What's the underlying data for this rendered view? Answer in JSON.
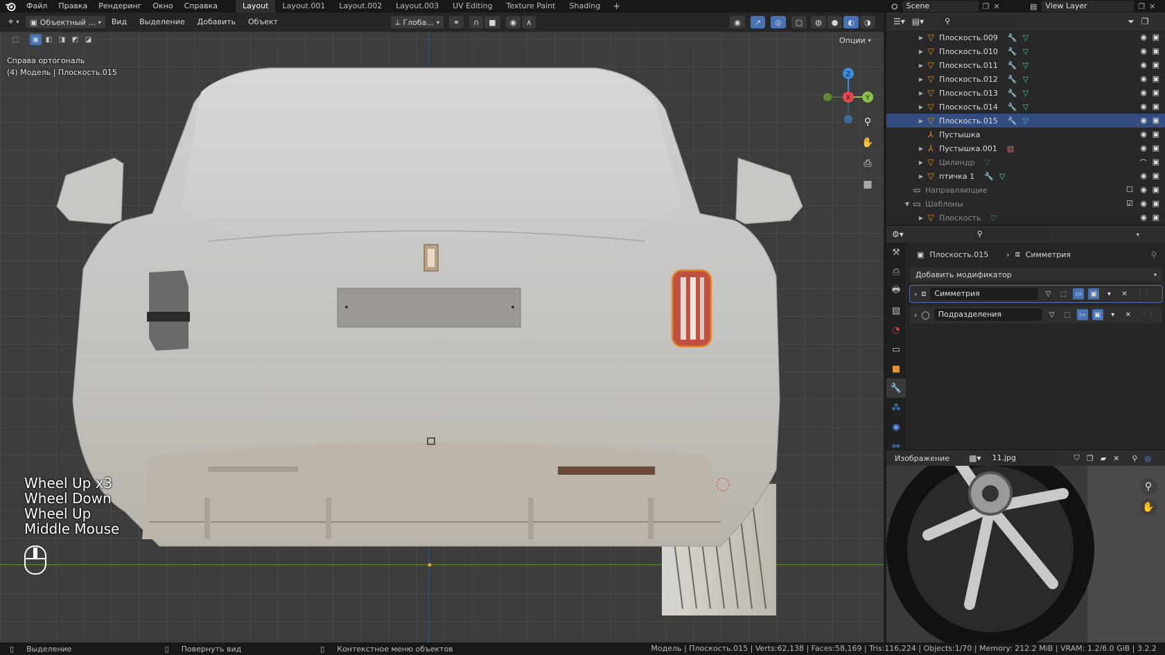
{
  "menu": [
    "Файл",
    "Правка",
    "Рендеринг",
    "Окно",
    "Справка"
  ],
  "workspace_tabs": [
    {
      "label": "Layout",
      "active": true
    },
    {
      "label": "Layout.001",
      "active": false
    },
    {
      "label": "Layout.002",
      "active": false
    },
    {
      "label": "Layout.003",
      "active": false
    },
    {
      "label": "UV Editing",
      "active": false
    },
    {
      "label": "Texture Paint",
      "active": false
    },
    {
      "label": "Shading",
      "active": false
    }
  ],
  "add_tab_glyph": "+",
  "scene": "Scene",
  "view_layer": "View Layer",
  "viewport": {
    "mode": "Объектный ...",
    "menus": [
      "Вид",
      "Выделение",
      "Добавить",
      "Объект"
    ],
    "transform_orientation": "Глоба...",
    "options": "Опции",
    "view_name": "Справа ортогональ",
    "object_info": "(4) Модель | Плоскость.015",
    "keys": [
      "Wheel Up x3",
      "Wheel Down",
      "Wheel Up",
      "Middle Mouse"
    ],
    "axes": {
      "x": "X",
      "y": "Y",
      "z": "Z"
    },
    "x_color": "#e8474f",
    "y_color": "#8bc34a",
    "z_color": "#3d8fdb"
  },
  "outliner": {
    "rows": [
      {
        "name": "Плоскость.009",
        "selected": false,
        "dim": false
      },
      {
        "name": "Плоскость.010",
        "selected": false,
        "dim": false
      },
      {
        "name": "Плоскость.011",
        "selected": false,
        "dim": false
      },
      {
        "name": "Плоскость.012",
        "selected": false,
        "dim": false
      },
      {
        "name": "Плоскость.013",
        "selected": false,
        "dim": false
      },
      {
        "name": "Плоскость.014",
        "selected": false,
        "dim": false
      },
      {
        "name": "Плоскость.015",
        "selected": true,
        "dim": false
      },
      {
        "name": "Пустышка",
        "selected": false,
        "dim": false
      },
      {
        "name": "Пустышка.001",
        "selected": false,
        "dim": false
      },
      {
        "name": "Цилиндр",
        "selected": false,
        "dim": true
      },
      {
        "name": "птичка 1",
        "selected": false,
        "dim": false
      },
      {
        "name": "Направляющие",
        "selected": false,
        "dim": true
      },
      {
        "name": "Шаблоны",
        "selected": false,
        "dim": true
      },
      {
        "name": "Плоскость",
        "selected": false,
        "dim": true
      }
    ]
  },
  "properties": {
    "object": "Плоскость.015",
    "modifier_context": "Симметрия",
    "add_modifier": "Добавить модификатор",
    "modifiers": [
      {
        "name": "Симметрия",
        "active": true
      },
      {
        "name": "Подразделения",
        "active": false
      }
    ]
  },
  "image_editor": {
    "mode": "Изображение",
    "image_name": "11.jpg"
  },
  "statusbar": {
    "select": "Выделение",
    "rotate": "Повернуть вид",
    "context": "Контекстное меню объектов",
    "stats": "Модель | Плоскость.015 | Verts:62,138 | Faces:58,169 | Tris:116,224 | Objects:1/70 | Memory: 212.2 MiB | VRAM: 1.2/6.0 GiB | 3.2.2"
  }
}
